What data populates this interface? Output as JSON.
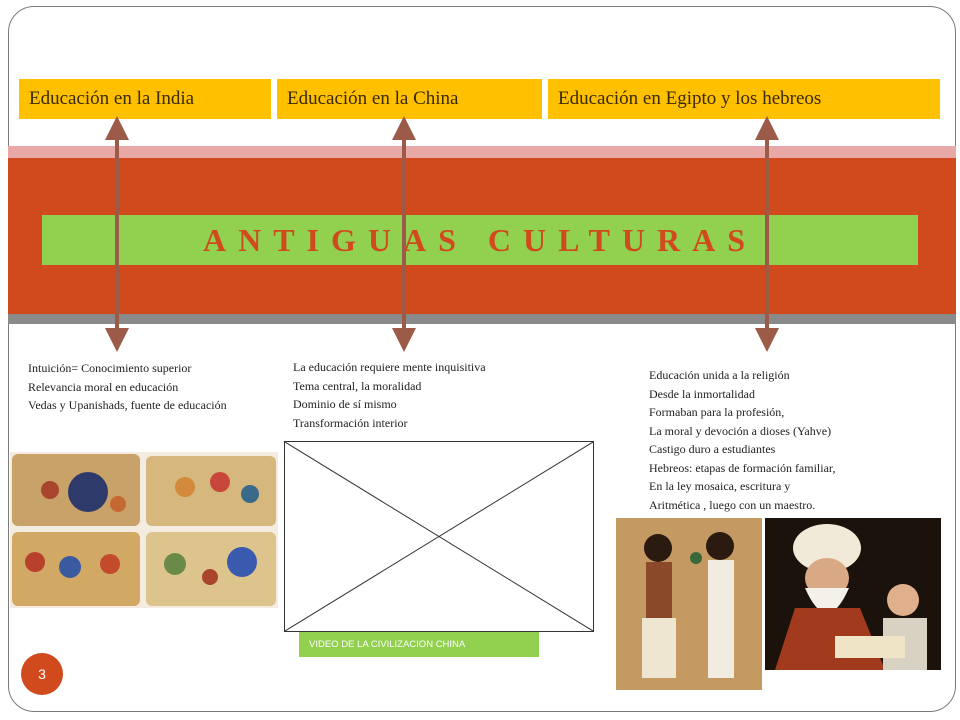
{
  "slide": {
    "headers": {
      "india": "Educación en la India",
      "china": "Educación en la China",
      "egypt": "Educación en Egipto y los hebreos"
    },
    "title": "ANTIGUAS    CULTURAS",
    "india_points": [
      "Intuición= Conocimiento superior",
      "Relevancia moral en educación",
      "Vedas y Upanishads, fuente de educación"
    ],
    "china_points": [
      "La educación requiere mente inquisitiva",
      "Tema central, la moralidad",
      "Dominio de sí mismo",
      "Transformación interior"
    ],
    "egypt_points": [
      "Educación  unida a la religión",
      "Desde la inmortalidad",
      "Formaban para la profesión,",
      "La moral y devoción a dioses (Yahve)",
      "Castigo duro a estudiantes",
      "Hebreos: etapas de formación familiar,",
      "En la ley mosaica, escritura y",
      "Aritmética , luego con un maestro."
    ],
    "video_label": "VIDEO DE LA CIVILIZACION CHINA",
    "page_number": "3"
  },
  "colors": {
    "accent_orange": "#d04a1d",
    "header_yellow": "#ffc000",
    "title_green": "#92d050",
    "arrow_brown": "#9c5a48"
  }
}
